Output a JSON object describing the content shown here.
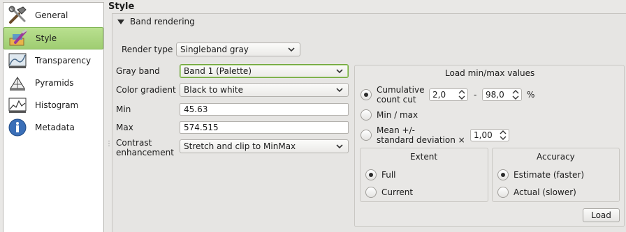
{
  "sidebar": {
    "items": [
      {
        "label": "General",
        "icon": "tools-icon"
      },
      {
        "label": "Style",
        "icon": "paintbrush-icon"
      },
      {
        "label": "Transparency",
        "icon": "transparency-icon"
      },
      {
        "label": "Pyramids",
        "icon": "pyramid-icon"
      },
      {
        "label": "Histogram",
        "icon": "histogram-icon"
      },
      {
        "label": "Metadata",
        "icon": "info-icon"
      }
    ],
    "active": "Style"
  },
  "page": {
    "title": "Style"
  },
  "band_rendering": {
    "header": "Band rendering",
    "render_type_label": "Render type",
    "render_type_value": "Singleband gray",
    "gray_band_label": "Gray band",
    "gray_band_value": "Band 1 (Palette)",
    "color_gradient_label": "Color gradient",
    "color_gradient_value": "Black to white",
    "min_label": "Min",
    "min_value": "45.63",
    "max_label": "Max",
    "max_value": "574.515",
    "contrast_label_line1": "Contrast",
    "contrast_label_line2": "enhancement",
    "contrast_value": "Stretch and clip to MinMax"
  },
  "minmax": {
    "title": "Load min/max values",
    "cumulative_line1": "Cumulative",
    "cumulative_line2": "count cut",
    "cumulative_low": "2,0",
    "dash": "-",
    "cumulative_high": "98,0",
    "percent": "%",
    "minmax_label": "Min / max",
    "mean_line1": "Mean +/-",
    "mean_line2": "standard deviation ×",
    "stddev_value": "1,00",
    "extent": {
      "title": "Extent",
      "full": "Full",
      "current": "Current"
    },
    "accuracy": {
      "title": "Accuracy",
      "estimate": "Estimate (faster)",
      "actual": "Actual (slower)"
    },
    "load_button": "Load"
  },
  "colors": {
    "accent_green": "#9fcd72",
    "focus_border": "#71a73c"
  }
}
